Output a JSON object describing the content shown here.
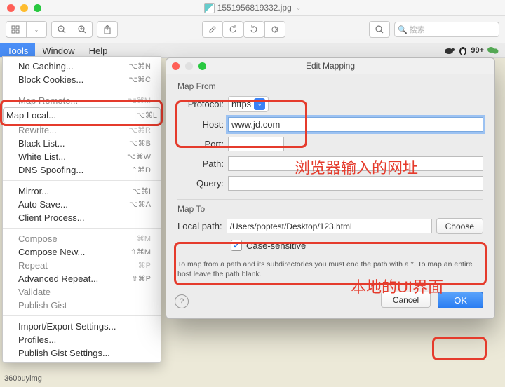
{
  "window": {
    "filename": "1551956819332.jpg"
  },
  "toolbar": {
    "search_placeholder": "搜索"
  },
  "menubar": {
    "items": [
      "Tools",
      "Window",
      "Help"
    ],
    "badge_count": "99+"
  },
  "tools_menu": {
    "no_caching": {
      "label": "No Caching...",
      "shortcut": "⌥⌘N"
    },
    "block_cookies": {
      "label": "Block Cookies...",
      "shortcut": "⌥⌘C"
    },
    "map_remote": {
      "label": "Map Remote...",
      "shortcut": "⌥⌘M"
    },
    "map_local": {
      "label": "Map Local...",
      "shortcut": "⌥⌘L"
    },
    "rewrite": {
      "label": "Rewrite...",
      "shortcut": "⌥⌘R"
    },
    "black_list": {
      "label": "Black List...",
      "shortcut": "⌥⌘B"
    },
    "white_list": {
      "label": "White List...",
      "shortcut": "⌥⌘W"
    },
    "dns_spoofing": {
      "label": "DNS Spoofing...",
      "shortcut": "⌃⌘D"
    },
    "mirror": {
      "label": "Mirror...",
      "shortcut": "⌥⌘I"
    },
    "auto_save": {
      "label": "Auto Save...",
      "shortcut": "⌥⌘A"
    },
    "client_process": {
      "label": "Client Process...",
      "shortcut": ""
    },
    "compose": {
      "label": "Compose",
      "shortcut": "⌘M"
    },
    "compose_new": {
      "label": "Compose New...",
      "shortcut": "⇧⌘M"
    },
    "repeat": {
      "label": "Repeat",
      "shortcut": "⌘P"
    },
    "adv_repeat": {
      "label": "Advanced Repeat...",
      "shortcut": "⇧⌘P"
    },
    "validate": {
      "label": "Validate",
      "shortcut": ""
    },
    "publish_gist": {
      "label": "Publish Gist",
      "shortcut": ""
    },
    "import_export": {
      "label": "Import/Export Settings...",
      "shortcut": ""
    },
    "profiles": {
      "label": "Profiles...",
      "shortcut": ""
    },
    "publish_gist_set": {
      "label": "Publish Gist Settings...",
      "shortcut": ""
    }
  },
  "dialog": {
    "title": "Edit Mapping",
    "map_from_label": "Map From",
    "map_to_label": "Map To",
    "fields": {
      "protocol_label": "Protocol:",
      "protocol_value": "https",
      "host_label": "Host:",
      "host_value": "www.jd.com",
      "port_label": "Port:",
      "port_value": "",
      "path_label": "Path:",
      "path_value": "",
      "query_label": "Query:",
      "query_value": "",
      "local_path_label": "Local path:",
      "local_path_value": "/Users/poptest/Desktop/123.html",
      "choose_label": "Choose",
      "case_sensitive_label": "Case-sensitive"
    },
    "hint": "To map from a path and its subdirectories you must end the path with a *. To map an entire host leave the path blank.",
    "buttons": {
      "cancel": "Cancel",
      "ok": "OK"
    }
  },
  "annotations": {
    "browser_url": "浏览器输入的网址",
    "local_ui": "本地的UI界面"
  },
  "background": {
    "text1": "360buyimg"
  }
}
